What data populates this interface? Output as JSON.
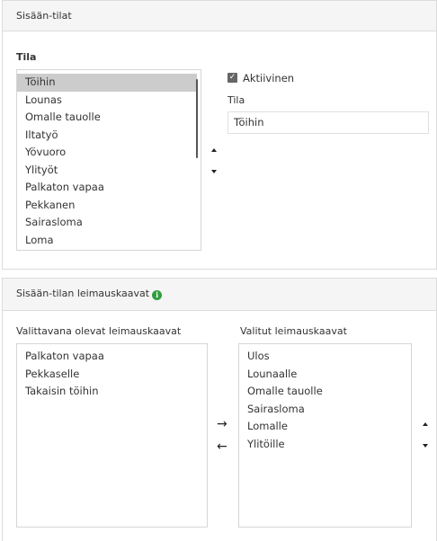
{
  "panel1": {
    "header": "Sisään-tilat",
    "section_label": "Tila",
    "list_items": [
      "Töihin",
      "Lounas",
      "Omalle tauolle",
      "Iltatyö",
      "Yövuoro",
      "Ylityöt",
      "Palkaton vapaa",
      "Pekkanen",
      "Sairasloma",
      "Loma"
    ],
    "selected_index": 0,
    "active_checkbox_label": "Aktiivinen",
    "active_checked": true,
    "name_field_label": "Tila",
    "name_field_value": "Töihin"
  },
  "panel2": {
    "header": "Sisään-tilan leimauskaavat",
    "available_label": "Valittavana olevat leimauskaavat",
    "available_items": [
      "Palkaton vapaa",
      "Pekkaselle",
      "Takaisin töihin"
    ],
    "selected_label": "Valitut leimauskaavat",
    "selected_items": [
      "Ulos",
      "Lounaalle",
      "Omalle tauolle",
      "Sairasloma",
      "Lomalle",
      "Ylitöille"
    ]
  },
  "icons": {
    "info": "info-icon",
    "move_up": "triangle-up-icon",
    "move_down": "triangle-down-icon",
    "move_right": "arrow-right-icon",
    "move_left": "arrow-left-icon",
    "check": "checkmark-icon"
  },
  "colors": {
    "info_icon": "#2e9e3e",
    "selected_row": "#cccccc",
    "header_bg": "#f5f5f5"
  }
}
